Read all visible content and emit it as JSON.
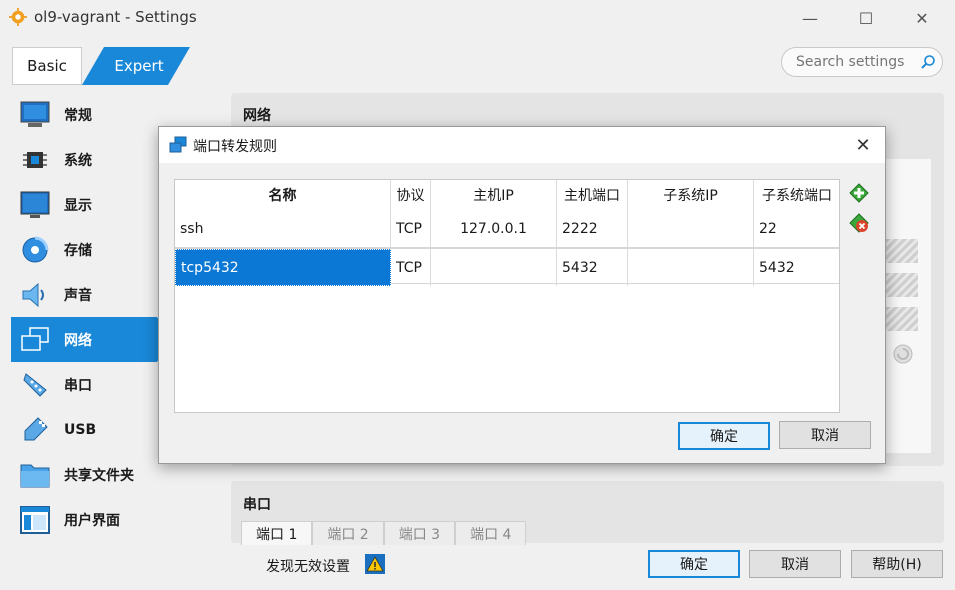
{
  "window": {
    "title": "ol9-vagrant - Settings",
    "minimize_label": "—",
    "maximize_label": "☐",
    "close_label": "✕"
  },
  "mode_tabs": {
    "basic": "Basic",
    "expert": "Expert"
  },
  "search": {
    "placeholder": "Search settings"
  },
  "sidebar": {
    "items": [
      {
        "label": "常规",
        "icon": "general-icon"
      },
      {
        "label": "系统",
        "icon": "chip-icon"
      },
      {
        "label": "显示",
        "icon": "monitor-icon"
      },
      {
        "label": "存储",
        "icon": "disk-icon"
      },
      {
        "label": "声音",
        "icon": "speaker-icon"
      },
      {
        "label": "网络",
        "icon": "network-icon",
        "active": true
      },
      {
        "label": "串口",
        "icon": "serial-icon"
      },
      {
        "label": "USB",
        "icon": "usb-icon"
      },
      {
        "label": "共享文件夹",
        "icon": "folder-icon"
      },
      {
        "label": "用户界面",
        "icon": "ui-icon"
      }
    ]
  },
  "network_group": {
    "title": "网络"
  },
  "serial_group": {
    "title": "串口",
    "tabs": [
      "端口 1",
      "端口 2",
      "端口 3",
      "端口 4"
    ]
  },
  "bottom": {
    "warning": "发现无效设置",
    "ok": "确定",
    "cancel": "取消",
    "help": "帮助(H)"
  },
  "dialog": {
    "title": "端口转发规则",
    "close_label": "✕",
    "columns": [
      "名称",
      "协议",
      "主机IP",
      "主机端口",
      "子系统IP",
      "子系统端口"
    ],
    "rows": [
      {
        "name": "ssh",
        "protocol": "TCP",
        "host_ip": "127.0.0.1",
        "host_port": "2222",
        "guest_ip": "",
        "guest_port": "22"
      },
      {
        "name": "tcp5432",
        "protocol": "TCP",
        "host_ip": "",
        "host_port": "5432",
        "guest_ip": "",
        "guest_port": "5432",
        "editing": true
      }
    ],
    "ok": "确定",
    "cancel": "取消"
  },
  "colors": {
    "accent": "#1a88d8",
    "selection": "#0a78d4",
    "add_green": "#3aa83a",
    "remove_red": "#d9442b"
  }
}
